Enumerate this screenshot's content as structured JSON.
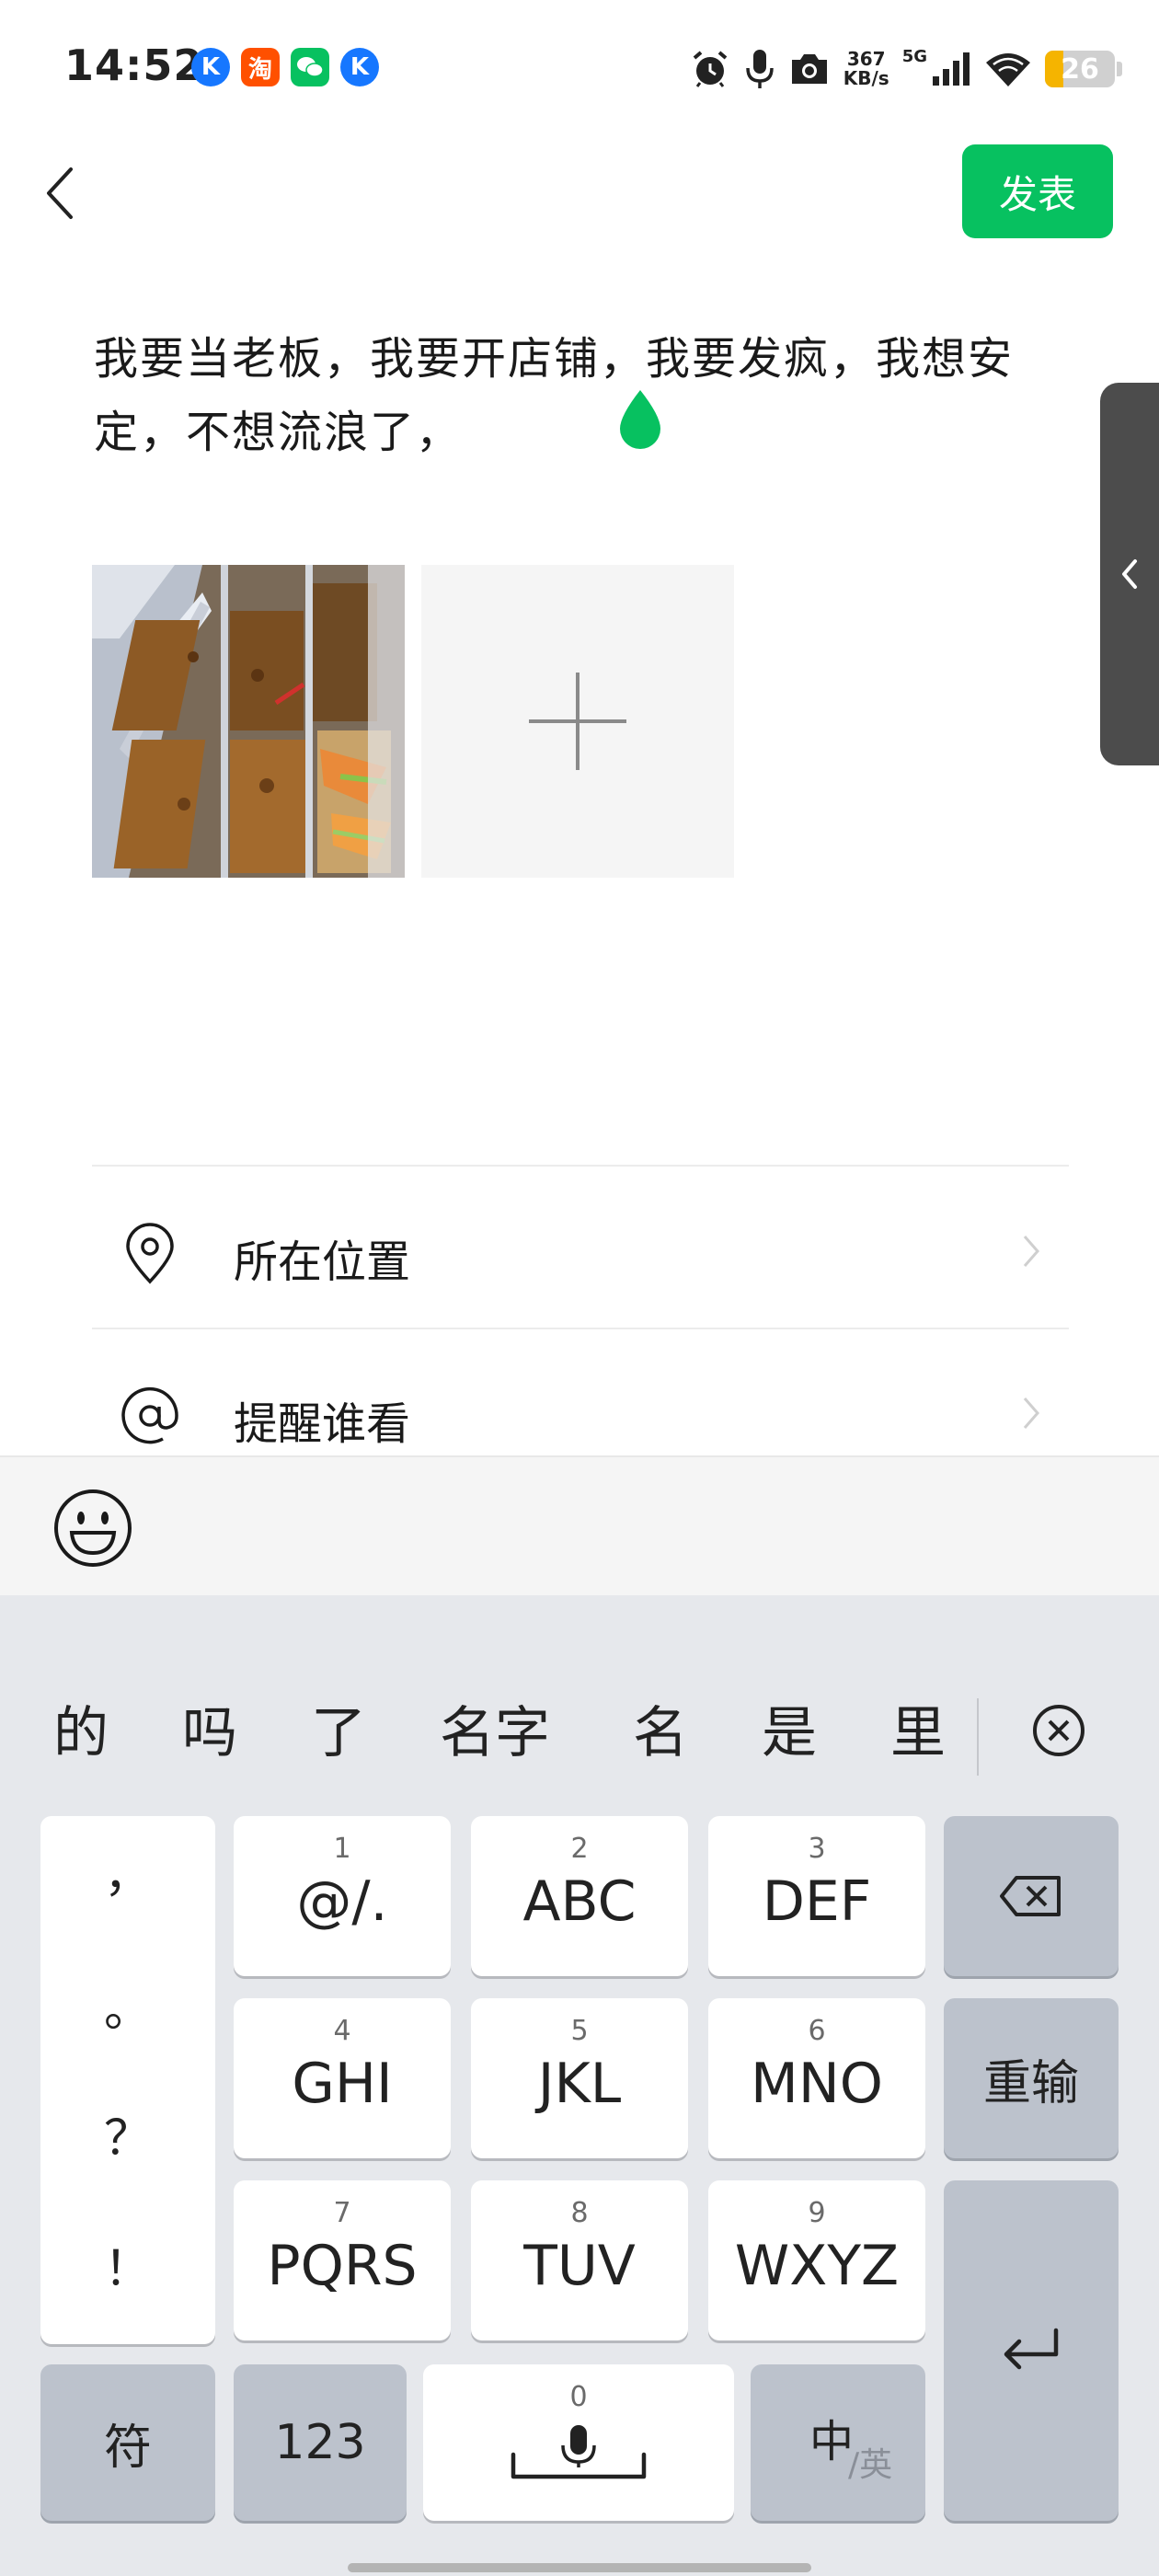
{
  "status_bar": {
    "time": "14:52",
    "notification_icons": [
      "k-app-icon",
      "taobao-icon",
      "wechat-icon",
      "k-app-icon"
    ],
    "taobao_glyph": "淘",
    "k_glyph": "K",
    "net_speed_value": "367",
    "net_speed_unit": "KB/s",
    "network_type": "5G",
    "battery_level": "26",
    "battery_fraction": 0.26
  },
  "header": {
    "publish_label": "发表"
  },
  "post": {
    "text": "我要当老板，我要开店铺，我要发疯，我想安定，不想流浪了，"
  },
  "options": [
    {
      "label": "所在位置",
      "icon": "location-pin-icon"
    },
    {
      "label": "提醒谁看",
      "icon": "at-icon"
    }
  ],
  "keyboard": {
    "candidates": [
      "的",
      "吗",
      "了",
      "名字",
      "名",
      "是",
      "里"
    ],
    "punctuation": [
      "，",
      "。",
      "？",
      "！"
    ],
    "keys": [
      {
        "num": "1",
        "letters": "@/."
      },
      {
        "num": "2",
        "letters": "ABC"
      },
      {
        "num": "3",
        "letters": "DEF"
      },
      {
        "num": "4",
        "letters": "GHI"
      },
      {
        "num": "5",
        "letters": "JKL"
      },
      {
        "num": "6",
        "letters": "MNO"
      },
      {
        "num": "7",
        "letters": "PQRS"
      },
      {
        "num": "8",
        "letters": "TUV"
      },
      {
        "num": "9",
        "letters": "WXYZ"
      }
    ],
    "reinput_label": "重输",
    "symbols_label": "符",
    "numbers_label": "123",
    "space_num": "0",
    "lang_main": "中",
    "lang_sub": "/英"
  },
  "colors": {
    "accent_green": "#07c160",
    "keyboard_bg": "#e6e8ec",
    "function_key": "#bcc2cc"
  }
}
